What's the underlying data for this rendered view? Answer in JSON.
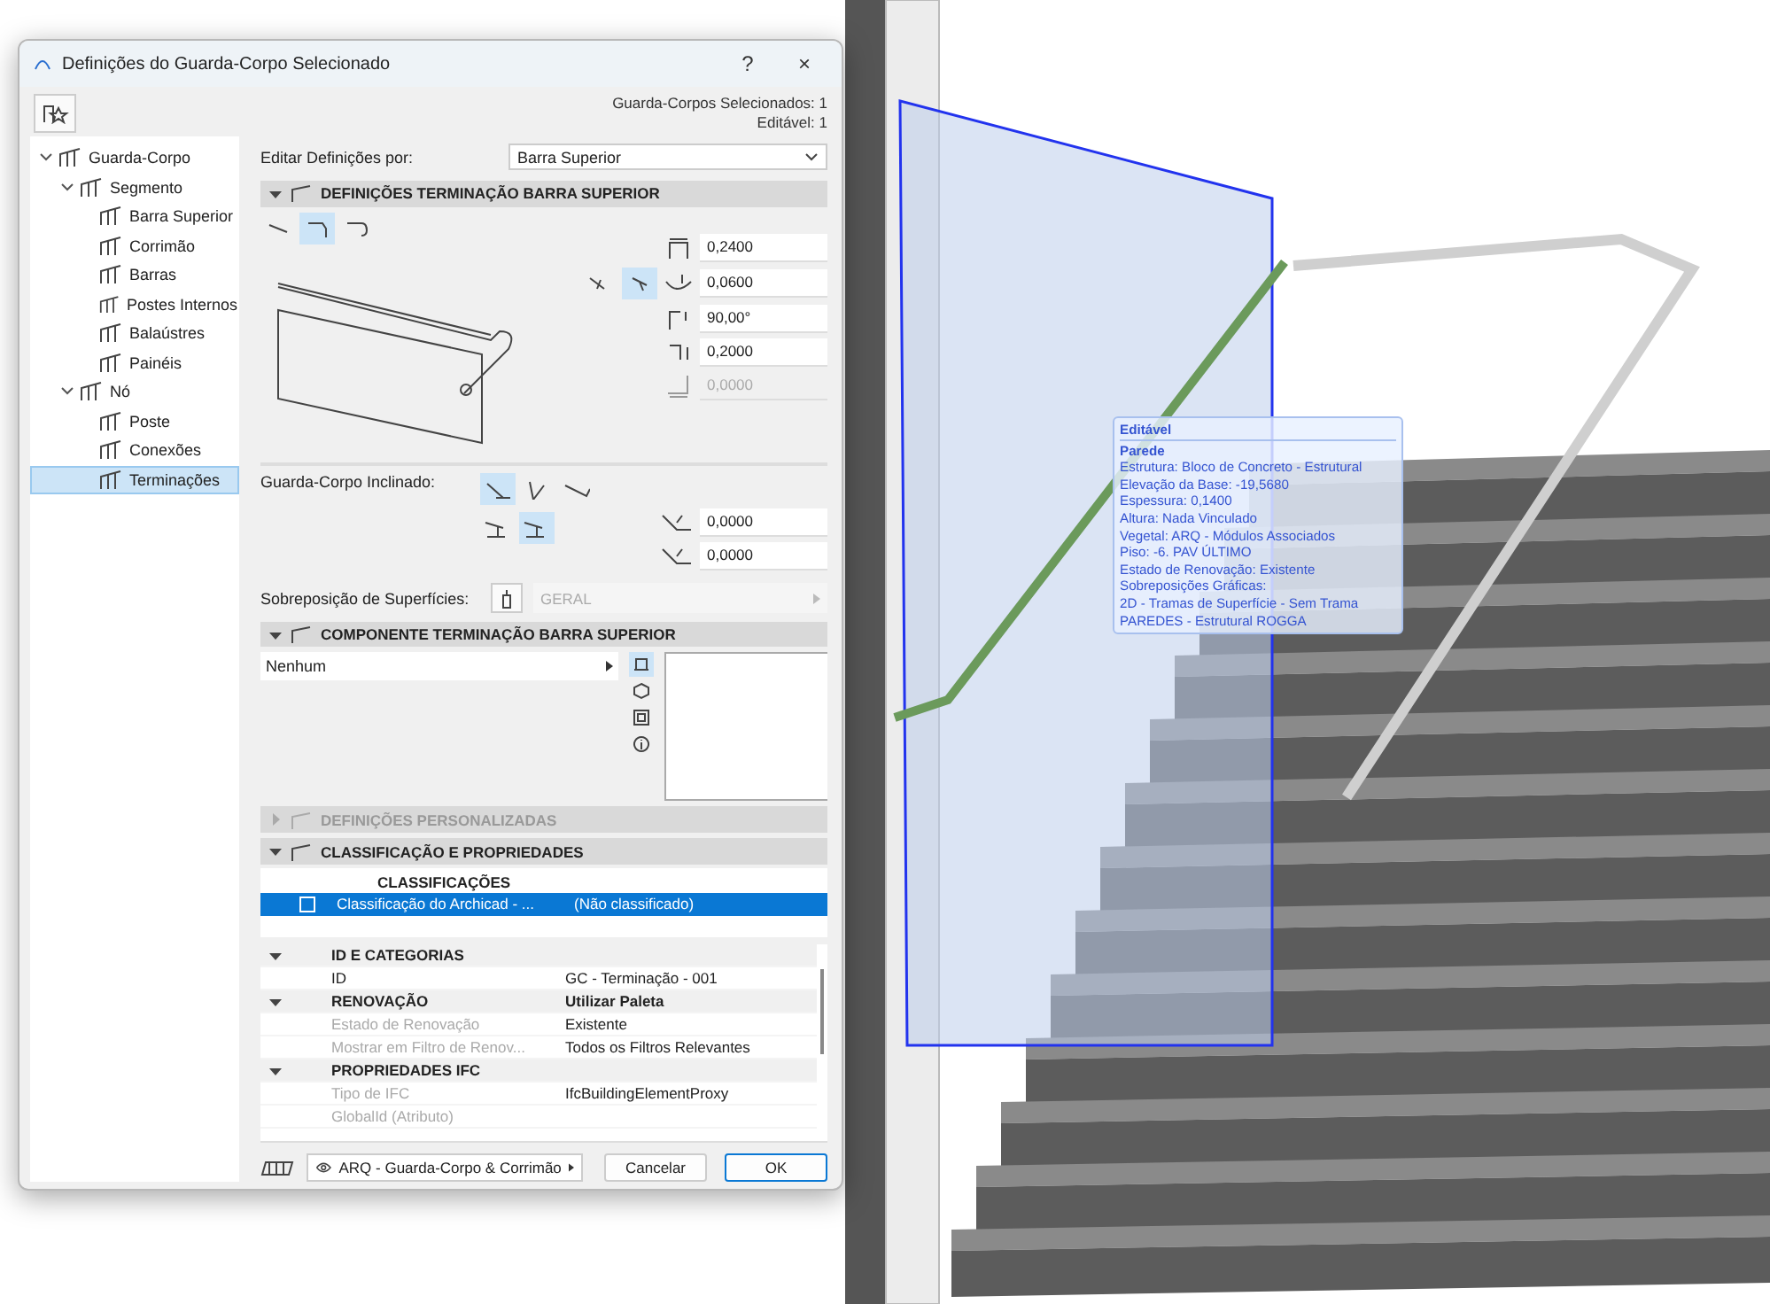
{
  "dialog": {
    "title": "Definições do Guarda-Corpo Selecionado",
    "help": "?",
    "close": "×",
    "selected_count": "Guarda-Corpos Selecionados: 1",
    "editable": "Editável: 1"
  },
  "tree": [
    {
      "label": "Guarda-Corpo",
      "expanded": true,
      "selected": false,
      "children": [
        {
          "label": "Segmento",
          "expanded": true,
          "selected": false,
          "children": [
            {
              "label": "Barra Superior",
              "selected": false
            },
            {
              "label": "Corrimão",
              "selected": false
            },
            {
              "label": "Barras",
              "selected": false
            },
            {
              "label": "Postes Internos",
              "selected": false
            },
            {
              "label": "Balaústres",
              "selected": false
            },
            {
              "label": "Painéis",
              "selected": false
            }
          ]
        },
        {
          "label": "Nó",
          "expanded": true,
          "selected": false,
          "children": [
            {
              "label": "Poste",
              "selected": false
            },
            {
              "label": "Conexões",
              "selected": false
            },
            {
              "label": "Terminações",
              "selected": true
            }
          ]
        }
      ]
    }
  ],
  "edit_by": {
    "label": "Editar Definições por:",
    "value": "Barra Superior"
  },
  "sections": [
    {
      "title": "DEFINIÇÕES TERMINAÇÃO BARRA SUPERIOR",
      "expanded": true,
      "disabled": false
    },
    {
      "title": "COMPONENTE TERMINAÇÃO BARRA SUPERIOR",
      "expanded": true,
      "disabled": false
    },
    {
      "title": "DEFINIÇÕES PERSONALIZADAS",
      "expanded": false,
      "disabled": true
    },
    {
      "title": "CLASSIFICAÇÃO E PROPRIEDADES",
      "expanded": true,
      "disabled": false
    }
  ],
  "end_types": [
    {
      "selected": false
    },
    {
      "selected": true
    },
    {
      "selected": false
    }
  ],
  "end_modes": [
    {
      "selected": false
    },
    {
      "selected": true
    }
  ],
  "end_fields": [
    {
      "value": "0,2400",
      "disabled": false
    },
    {
      "value": "0,0600",
      "disabled": false
    },
    {
      "value": "90,00°",
      "disabled": false
    },
    {
      "value": "0,2000",
      "disabled": false
    },
    {
      "value": "0,0000",
      "disabled": true
    }
  ],
  "inclined": {
    "label": "Guarda-Corpo Inclinado:",
    "options": [
      {
        "selected": true
      },
      {
        "selected": false
      },
      {
        "selected": false
      }
    ],
    "steps": [
      {
        "selected": false
      },
      {
        "selected": true
      }
    ],
    "fields": [
      {
        "value": "0,0000"
      },
      {
        "value": "0,0000"
      }
    ]
  },
  "surface": {
    "label": "Sobreposição de Superfícies:",
    "value": "GERAL"
  },
  "component": {
    "value": "Nenhum",
    "views": [
      {
        "selected": true
      },
      {
        "selected": false
      },
      {
        "selected": false
      },
      {
        "selected": false
      }
    ]
  },
  "classifications": {
    "title": "CLASSIFICAÇÕES",
    "rows": [
      {
        "name": "Classificação do Archicad - ...",
        "value": "(Não classificado)",
        "checked": false,
        "selected": true
      }
    ]
  },
  "properties": [
    {
      "title": "ID E CATEGORIAS",
      "expanded": true,
      "rows": [
        {
          "name": "ID",
          "value": "GC - Terminação - 001",
          "disabled": false
        }
      ]
    },
    {
      "title": "RENOVAÇÃO",
      "value": "Utilizar Paleta",
      "expanded": true,
      "rows": [
        {
          "name": "Estado de Renovação",
          "value": "Existente",
          "disabled": true
        },
        {
          "name": "Mostrar em Filtro de Renov...",
          "value": "Todos os Filtros Relevantes",
          "disabled": true
        }
      ]
    },
    {
      "title": "PROPRIEDADES IFC",
      "expanded": true,
      "rows": [
        {
          "name": "Tipo de IFC",
          "value": "IfcBuildingElementProxy",
          "disabled": true
        },
        {
          "name": "GlobalId (Atributo)",
          "disabled": true
        }
      ]
    }
  ],
  "footer": {
    "layer": "ARQ - Guarda-Corpo & Corrimão",
    "buttons": [
      "Cancelar",
      "OK"
    ]
  },
  "tooltip": {
    "title": "Editável",
    "heading": "Parede",
    "lines": [
      "Estrutura: Bloco de Concreto - Estrutural",
      "Elevação da Base: -19,5680",
      "Espessura: 0,1400",
      "Altura: Nada Vinculado",
      "Vegetal: ARQ - Módulos Associados",
      "Piso: -6. PAV ÚLTIMO",
      "Estado de Renovação: Existente",
      "Sobreposições Gráficas:",
      "2D - Tramas de Superfície - Sem Trama",
      "PAREDES - Estrutural ROGGA"
    ]
  }
}
